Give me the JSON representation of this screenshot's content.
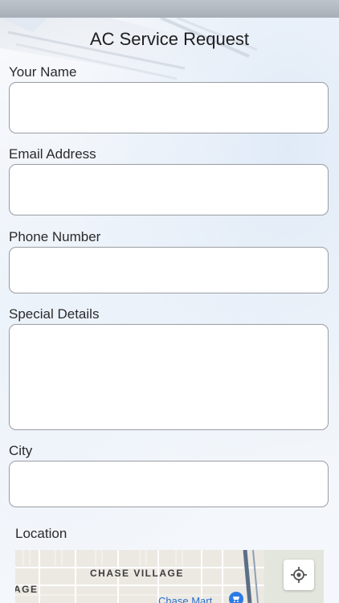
{
  "header": {
    "title": "AC Service Request"
  },
  "form": {
    "name_label": "Your Name",
    "name_value": "",
    "email_label": "Email Address",
    "email_value": "",
    "phone_label": "Phone Number",
    "phone_value": "",
    "details_label": "Special Details",
    "details_value": "",
    "city_label": "City",
    "city_value": ""
  },
  "location": {
    "label": "Location",
    "map": {
      "neighborhood": "CHASE VILLAGE",
      "edge_label": "AGE",
      "poi": "Chase Mart"
    }
  },
  "colors": {
    "background": "#f6f8fb",
    "field_border": "#9a9da3",
    "poi_blue": "#2c6fc7",
    "highway": "#5b6f86"
  },
  "icons": {
    "locate": "crosshair-icon",
    "poi": "shopping-cart-pin-icon"
  }
}
